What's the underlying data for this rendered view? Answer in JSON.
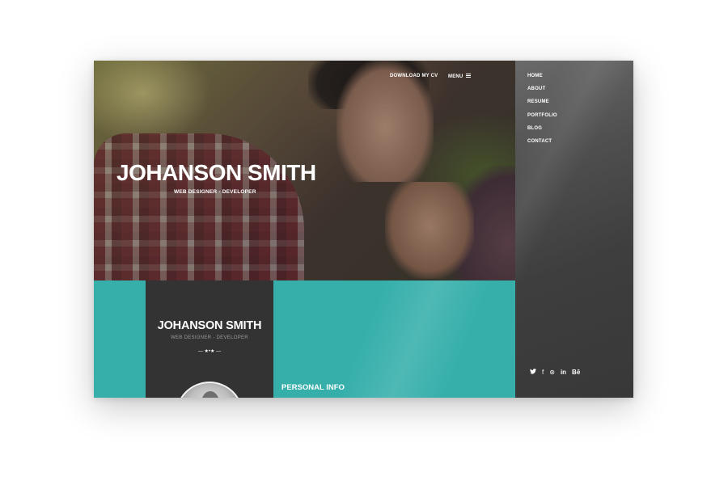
{
  "hero": {
    "nav": {
      "download_cv": "DOWNLOAD MY CV",
      "menu": "MENU"
    },
    "title": "JOHANSON SMITH",
    "subtitle": "WEB DESIGNER - DEVELOPER"
  },
  "profile": {
    "name": "JOHANSON SMITH",
    "role": "WEB DESIGNER - DEVELOPER",
    "divider": "— ★•★ —"
  },
  "section": {
    "title": "PERSONAL INFO"
  },
  "sidebar": {
    "items": [
      {
        "label": "HOME"
      },
      {
        "label": "ABOUT"
      },
      {
        "label": "RESUME"
      },
      {
        "label": "PORTFOLIO"
      },
      {
        "label": "BLOG"
      },
      {
        "label": "CONTACT"
      }
    ]
  },
  "social": [
    {
      "icon": "twitter-icon",
      "glyph": "🐦"
    },
    {
      "icon": "facebook-icon",
      "glyph": "f"
    },
    {
      "icon": "dribbble-icon",
      "glyph": "⊛"
    },
    {
      "icon": "linkedin-icon",
      "glyph": "in"
    },
    {
      "icon": "behance-icon",
      "glyph": "Bē"
    }
  ],
  "colors": {
    "accent_teal": "#36afab",
    "card_dark": "#333333",
    "sidebar_dark": "#3e3e3e"
  }
}
